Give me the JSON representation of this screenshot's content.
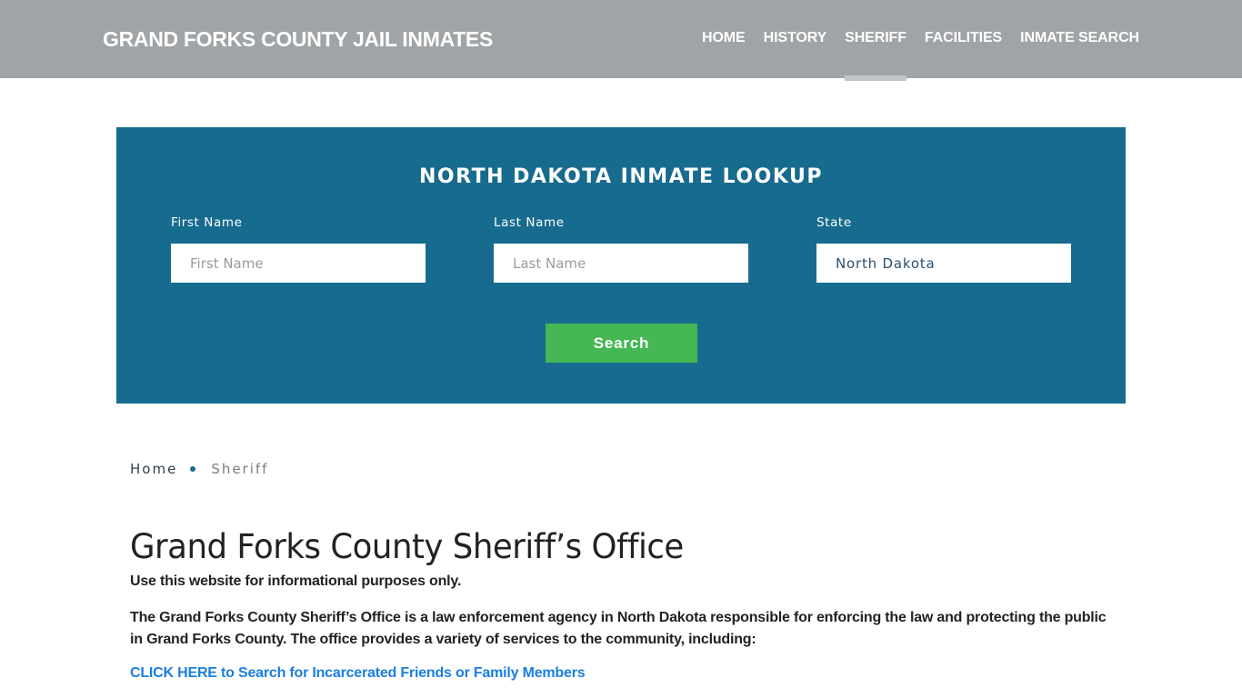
{
  "header": {
    "brand": "GRAND FORKS COUNTY JAIL INMATES",
    "nav": [
      {
        "label": "HOME",
        "active": false
      },
      {
        "label": "HISTORY",
        "active": false
      },
      {
        "label": "SHERIFF",
        "active": true
      },
      {
        "label": "FACILITIES",
        "active": false
      },
      {
        "label": "INMATE SEARCH",
        "active": false
      }
    ]
  },
  "lookup": {
    "title": "NORTH DAKOTA INMATE LOOKUP",
    "first_name": {
      "label": "First Name",
      "placeholder": "First Name",
      "value": ""
    },
    "last_name": {
      "label": "Last Name",
      "placeholder": "Last Name",
      "value": ""
    },
    "state": {
      "label": "State",
      "value": "North Dakota"
    },
    "search_label": "Search",
    "colors": {
      "panel": "#176b8e",
      "button": "#46b755"
    }
  },
  "breadcrumb": {
    "home": "Home",
    "current": "Sheriff"
  },
  "content": {
    "title": "Grand Forks County Sheriff’s Office",
    "note": "Use this website for informational purposes only.",
    "description": "The Grand Forks County Sheriff’s Office is a law enforcement agency in North Dakota responsible for enforcing the law and protecting the public in Grand Forks County. The office provides a variety of services to the community, including:",
    "cta_link": "CLICK HERE to Search for Incarcerated Friends or Family Members"
  }
}
